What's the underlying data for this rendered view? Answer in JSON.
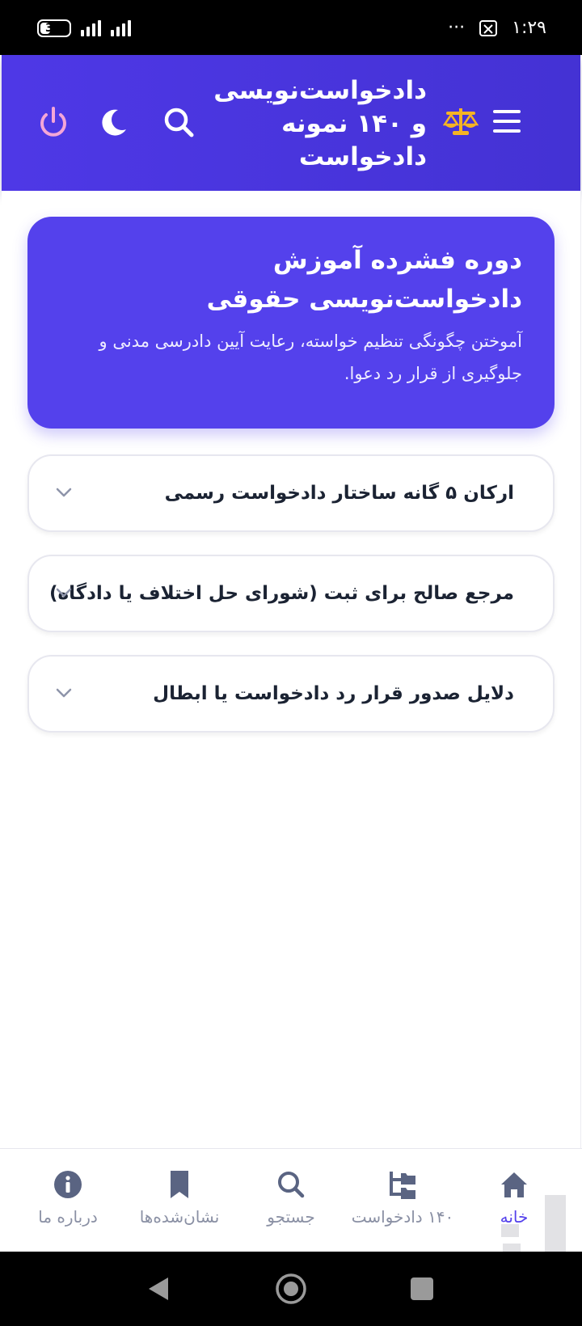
{
  "status": {
    "battery": "30",
    "time": "۱:۲۹",
    "dots": "···"
  },
  "header": {
    "title_lines": [
      "دادخواست‌نویسی",
      "و ۱۴۰ نمونه",
      "دادخواست"
    ]
  },
  "hero": {
    "title": "دوره فشرده آموزش دادخواست‌نویسی حقوقی",
    "description": "آموختن چگونگی تنظیم خواسته، رعایت آیین دادرسی مدنی و جلوگیری از قرار رد دعوا."
  },
  "accordion": [
    {
      "label": "ارکان ۵ گانه ساختار دادخواست رسمی"
    },
    {
      "label": "مرجع صالح برای ثبت (شورای حل اختلاف یا دادگاه)"
    },
    {
      "label": "دلایل صدور قرار رد دادخواست یا ابطال"
    }
  ],
  "bottom_nav": [
    {
      "label": "خانه",
      "icon": "home-icon",
      "active": true
    },
    {
      "label": "۱۴۰ دادخواست",
      "icon": "folder-tree-icon",
      "active": false
    },
    {
      "label": "جستجو",
      "icon": "search-icon",
      "active": false
    },
    {
      "label": "نشان‌شده‌ها",
      "icon": "bookmark-icon",
      "active": false
    },
    {
      "label": "درباره ما",
      "icon": "info-icon",
      "active": false
    }
  ],
  "colors": {
    "primary": "#5441ec",
    "header": "#4a36e0",
    "accent_gold": "#f5b324",
    "power_pink": "#f4a6d7",
    "muted": "#8a90a4"
  }
}
